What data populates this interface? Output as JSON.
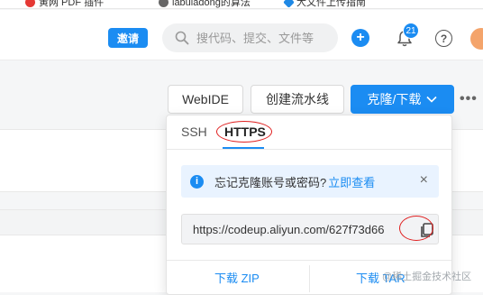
{
  "bookmarks": [
    {
      "label": "黄网 PDF 插件"
    },
    {
      "label": "labuladong的算法"
    },
    {
      "label": "大文件上传指南"
    }
  ],
  "header": {
    "invite_label": "邀请",
    "search_placeholder": "搜代码、提交、文件等",
    "notification_count": "21",
    "help_label": "?",
    "avatar_text": ""
  },
  "toolbar": {
    "webide_label": "WebIDE",
    "pipeline_label": "创建流水线",
    "clone_label": "克隆/下载",
    "more_label": "•••"
  },
  "clone_panel": {
    "tabs": [
      {
        "label": "SSH",
        "active": false
      },
      {
        "label": "HTTPS",
        "active": true
      }
    ],
    "notice_text": "忘记克隆账号或密码?",
    "notice_link": "立即查看",
    "notice_close": "×",
    "url": "https://codeup.aliyun.com/627f73d66",
    "download_zip": "下载 ZIP",
    "download_tar": "下载 TAR"
  },
  "watermark": "@稀土掘金技术社区",
  "colors": {
    "accent": "#1b8cf2",
    "annotation_red": "#e02020"
  }
}
